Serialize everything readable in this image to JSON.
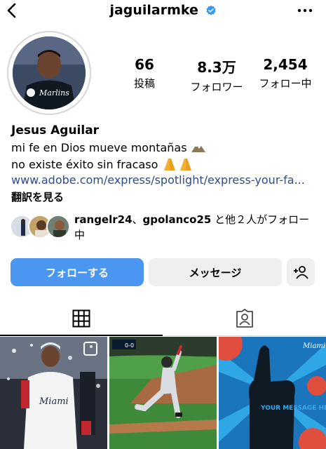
{
  "header": {
    "username": "jaguilarmke"
  },
  "stats": [
    {
      "value": "66",
      "label": "投稿"
    },
    {
      "value": "8.3万",
      "label": "フォロワー"
    },
    {
      "value": "2,454",
      "label": "フォロー中"
    }
  ],
  "profile": {
    "name": "Jesus Aguilar",
    "bio_line1": "mi fe en Dios mueve montañas",
    "bio_line2": "no existe éxito sin fracaso",
    "link": "www.adobe.com/express/spotlight/express-your-fa...",
    "translate": "翻訳を見る"
  },
  "followed_by": {
    "user1": "rangelr24",
    "separator": "、",
    "user2": "gpolanco25",
    "suffix": "と他２人がフォロー中"
  },
  "actions": {
    "follow": "フォローする",
    "message": "メッセージ"
  },
  "grid_posts": [
    {
      "badge": "Miami"
    },
    {
      "scoreboard": "0-0"
    },
    {
      "text": "YOUR MESSAGE HERE",
      "corner": "Miami"
    }
  ],
  "colors": {
    "accent": "#4a96f0",
    "link": "#2d4c8c",
    "verified": "#3897f0"
  }
}
